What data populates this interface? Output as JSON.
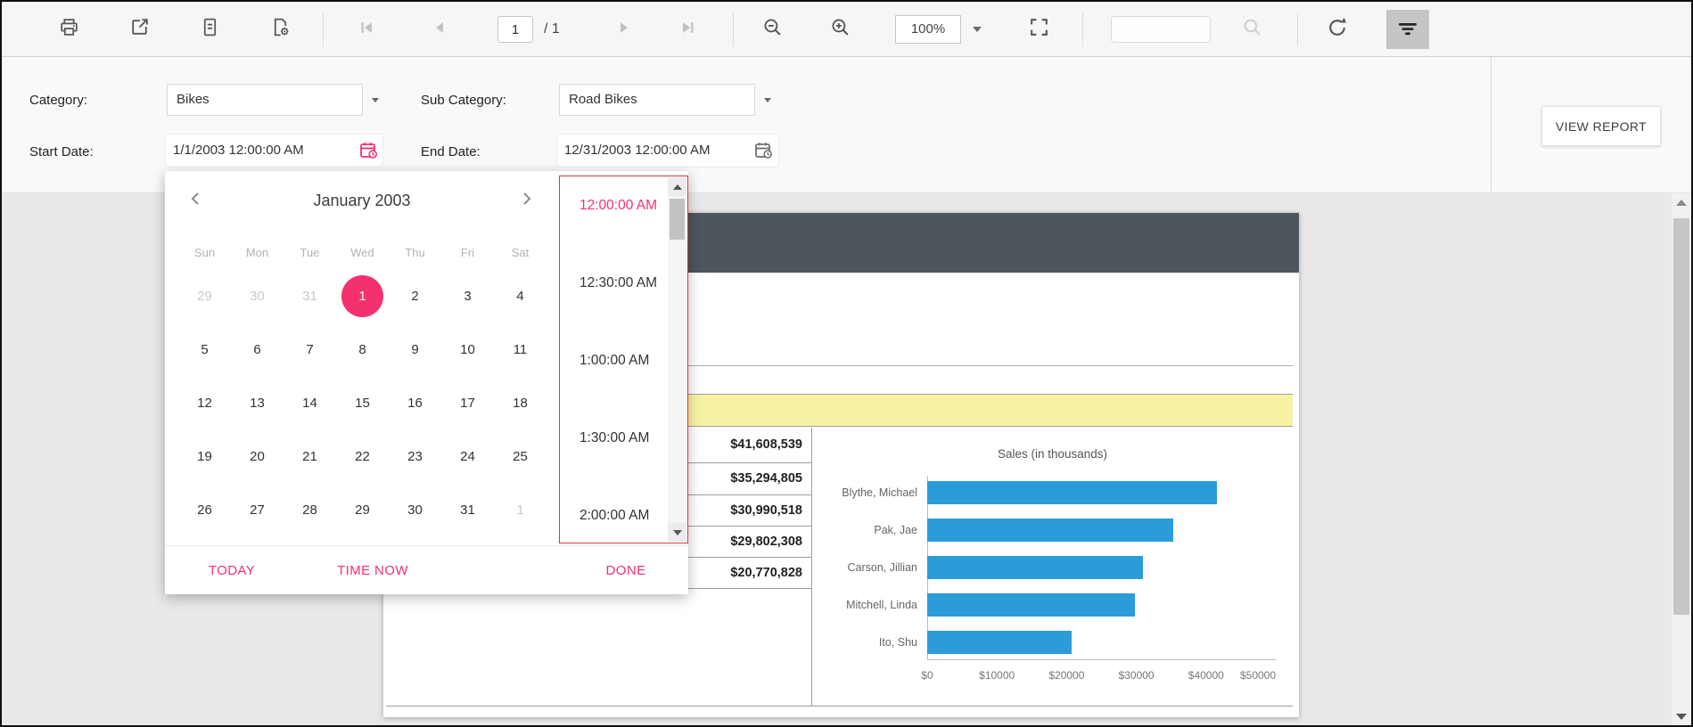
{
  "colors": {
    "accent_pink": "#f4306e",
    "time_border_red": "#e5333c",
    "bar_blue": "#2b9cd8",
    "report_header_dark": "#4e555d",
    "group_header_yellow": "#f8f3a3"
  },
  "toolbar": {
    "page_input": "1",
    "page_total": "/ 1",
    "zoom_value": "100%",
    "search_value": "",
    "icons": [
      "print-icon",
      "export-icon",
      "print-layout-icon",
      "page-setup-icon",
      "first-page-icon",
      "previous-page-icon",
      "next-page-icon",
      "last-page-icon",
      "zoom-out-icon",
      "zoom-in-icon",
      "fit-to-page-icon",
      "search-icon",
      "refresh-icon",
      "parameters-icon"
    ]
  },
  "parameters": {
    "category": {
      "label": "Category:",
      "value": "Bikes"
    },
    "subcategory": {
      "label": "Sub Category:",
      "value": "Road Bikes"
    },
    "start_date": {
      "label": "Start Date:",
      "value": "1/1/2003 12:00:00 AM"
    },
    "end_date": {
      "label": "End Date:",
      "value": "12/31/2003 12:00:00 AM"
    },
    "view_report": "VIEW REPORT"
  },
  "picker": {
    "month_title": "January 2003",
    "day_headers": [
      "Sun",
      "Mon",
      "Tue",
      "Wed",
      "Thu",
      "Fri",
      "Sat"
    ],
    "weeks": [
      [
        {
          "d": "29",
          "muted": true
        },
        {
          "d": "30",
          "muted": true
        },
        {
          "d": "31",
          "muted": true
        },
        {
          "d": "1",
          "selected": true
        },
        {
          "d": "2"
        },
        {
          "d": "3"
        },
        {
          "d": "4"
        }
      ],
      [
        {
          "d": "5"
        },
        {
          "d": "6"
        },
        {
          "d": "7"
        },
        {
          "d": "8"
        },
        {
          "d": "9"
        },
        {
          "d": "10"
        },
        {
          "d": "11"
        }
      ],
      [
        {
          "d": "12"
        },
        {
          "d": "13"
        },
        {
          "d": "14"
        },
        {
          "d": "15"
        },
        {
          "d": "16"
        },
        {
          "d": "17"
        },
        {
          "d": "18"
        }
      ],
      [
        {
          "d": "19"
        },
        {
          "d": "20"
        },
        {
          "d": "21"
        },
        {
          "d": "22"
        },
        {
          "d": "23"
        },
        {
          "d": "24"
        },
        {
          "d": "25"
        }
      ],
      [
        {
          "d": "26"
        },
        {
          "d": "27"
        },
        {
          "d": "28"
        },
        {
          "d": "29"
        },
        {
          "d": "30"
        },
        {
          "d": "31"
        },
        {
          "d": "1",
          "muted": true
        }
      ]
    ],
    "times": [
      {
        "label": "12:00:00 AM",
        "selected": true
      },
      {
        "label": "12:30:00 AM"
      },
      {
        "label": "1:00:00 AM"
      },
      {
        "label": "1:30:00 AM"
      },
      {
        "label": "2:00:00 AM"
      }
    ],
    "today_label": "TODAY",
    "time_now_label": "TIME NOW",
    "done_label": "DONE"
  },
  "report": {
    "sales_values": [
      "$41,608,539",
      "$35,294,805",
      "$30,990,518",
      "$29,802,308",
      "$20,770,828"
    ],
    "chart_data": {
      "type": "bar",
      "orientation": "horizontal",
      "title": "Sales (in thousands)",
      "categories": [
        "Blythe, Michael",
        "Pak, Jae",
        "Carson, Jillian",
        "Mitchell, Linda",
        "Ito, Shu"
      ],
      "values": [
        41608,
        35294,
        30990,
        29802,
        20770
      ],
      "x_ticks": [
        "$0",
        "$10000",
        "$20000",
        "$30000",
        "$40000",
        "$50000"
      ],
      "xlim": [
        0,
        50000
      ],
      "bar_color": "#2b9cd8",
      "grid": false,
      "legend": "none"
    }
  }
}
